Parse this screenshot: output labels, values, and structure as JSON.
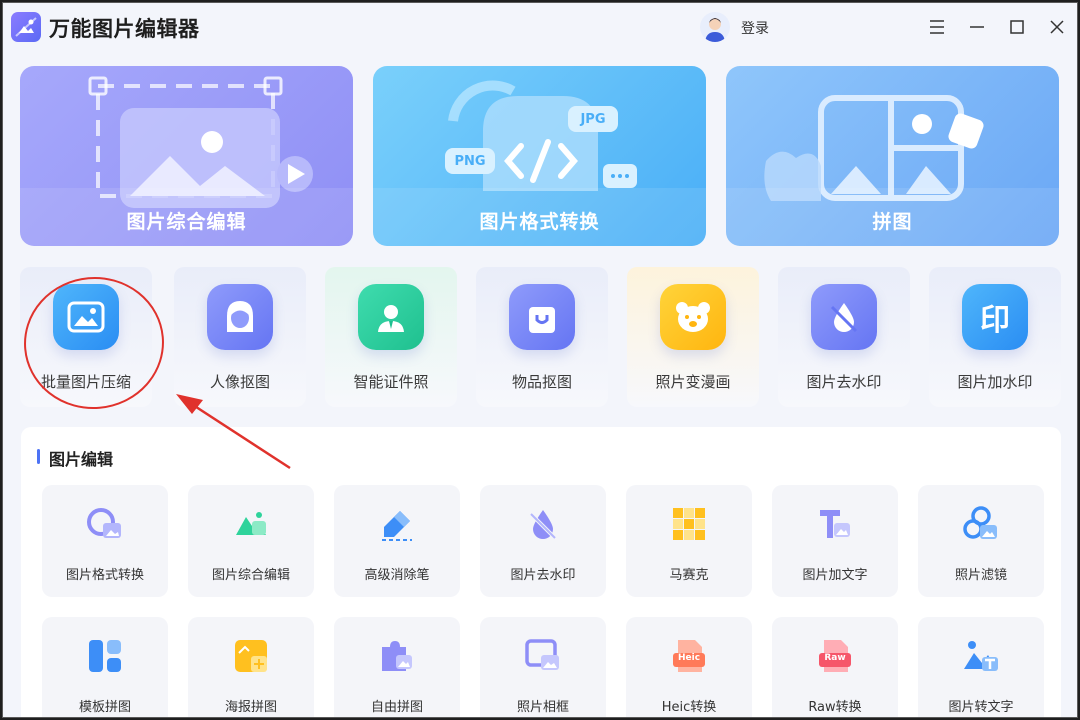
{
  "app": {
    "title": "万能图片编辑器",
    "login_label": "登录"
  },
  "hero_cards": [
    {
      "label": "图片综合编辑"
    },
    {
      "label": "图片格式转换",
      "badges": {
        "jpg": "JPG",
        "png": "PNG"
      }
    },
    {
      "label": "拼图"
    }
  ],
  "tools": [
    {
      "label": "批量图片压缩"
    },
    {
      "label": "人像抠图"
    },
    {
      "label": "智能证件照"
    },
    {
      "label": "物品抠图"
    },
    {
      "label": "照片变漫画"
    },
    {
      "label": "图片去水印"
    },
    {
      "label": "图片加水印",
      "glyph": "印"
    }
  ],
  "panel": {
    "title": "图片编辑",
    "row1": [
      {
        "label": "图片格式转换"
      },
      {
        "label": "图片综合编辑"
      },
      {
        "label": "高级消除笔"
      },
      {
        "label": "图片去水印"
      },
      {
        "label": "马赛克"
      },
      {
        "label": "图片加文字"
      },
      {
        "label": "照片滤镜"
      }
    ],
    "row2": [
      {
        "label": "模板拼图"
      },
      {
        "label": "海报拼图"
      },
      {
        "label": "自由拼图"
      },
      {
        "label": "照片相框"
      },
      {
        "label": "Heic转换",
        "badge": "Heic"
      },
      {
        "label": "Raw转换",
        "badge": "Raw"
      },
      {
        "label": "图片转文字"
      }
    ]
  },
  "colors": {
    "accent": "#4d73f5",
    "annotation_red": "#e0322c"
  }
}
